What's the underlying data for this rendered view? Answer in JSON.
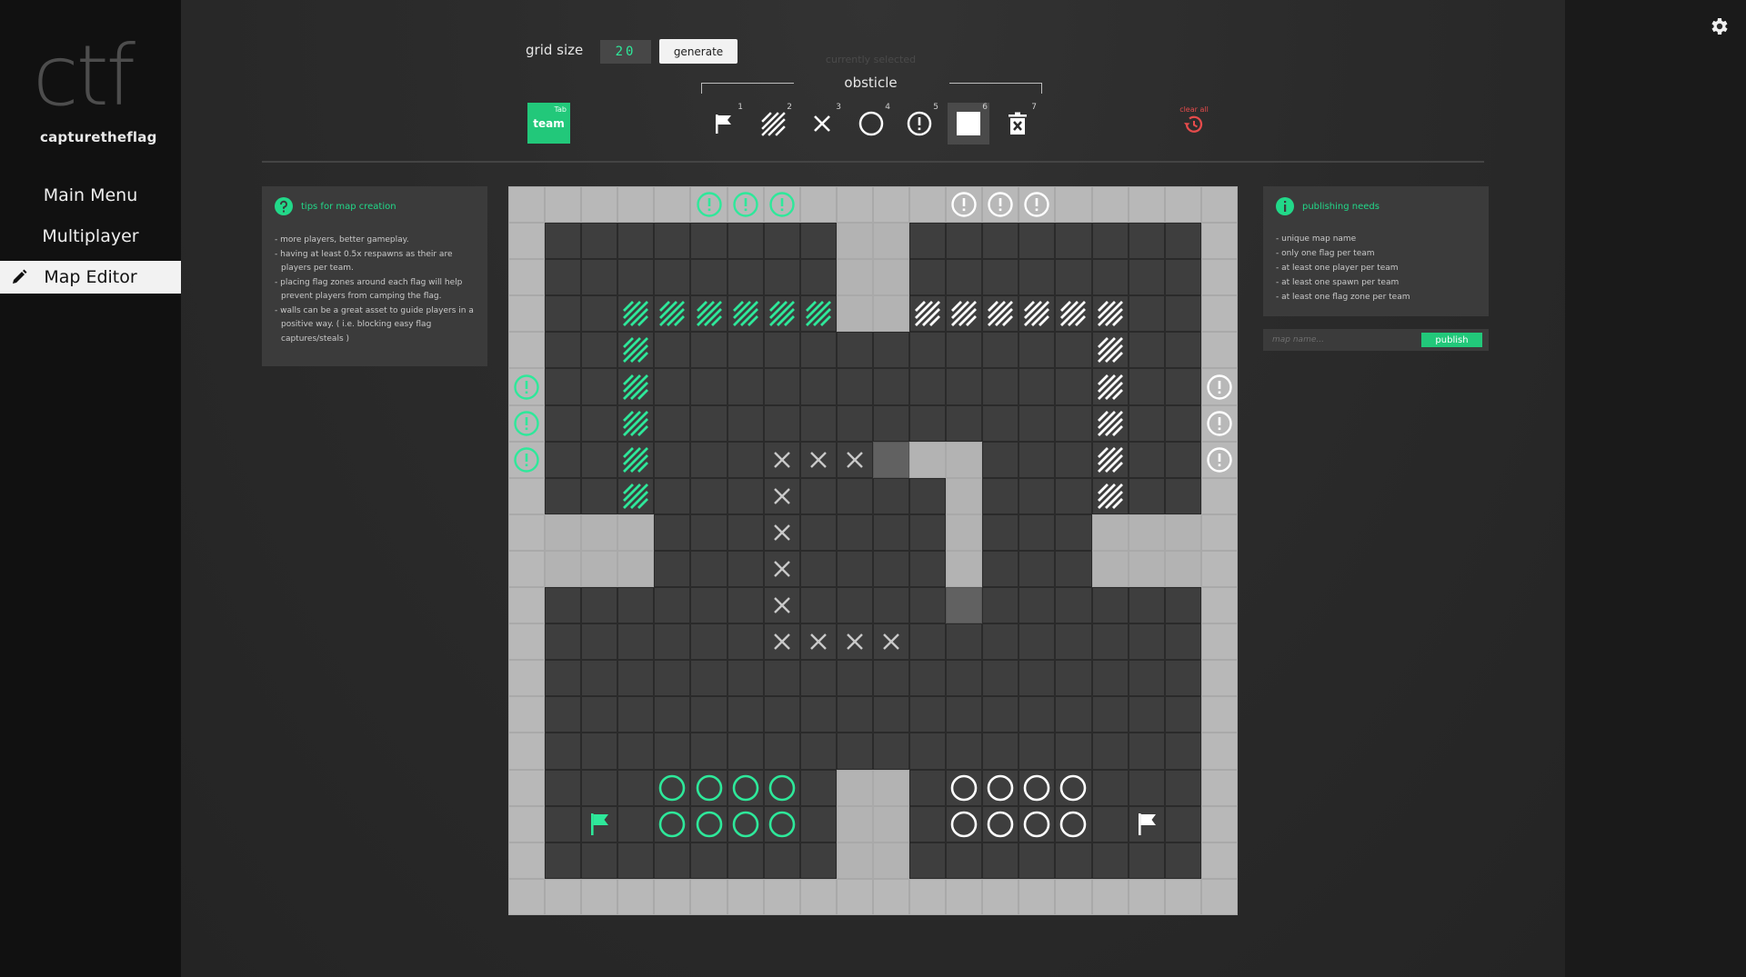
{
  "app": {
    "logo": "ctf",
    "logo_subtitle": "capturetheflag"
  },
  "sidebar": {
    "items": [
      {
        "label": "Main Menu"
      },
      {
        "label": "Multiplayer"
      },
      {
        "label": "Map Editor",
        "active": true,
        "icon": "pencil-icon"
      }
    ]
  },
  "toolbar": {
    "grid_size_label": "grid size",
    "grid_size_value": "20",
    "generate_label": "generate",
    "currently_selected_label": "currently selected",
    "obstacle_label": "obsticle",
    "team_label": "team",
    "team_hint": "Tab",
    "clear_all_label": "clear all",
    "tools": [
      {
        "key": "1",
        "icon": "flag-icon"
      },
      {
        "key": "2",
        "icon": "hatch-icon"
      },
      {
        "key": "3",
        "icon": "x-mark-icon"
      },
      {
        "key": "4",
        "icon": "circle-icon"
      },
      {
        "key": "5",
        "icon": "alert-icon"
      },
      {
        "key": "6",
        "icon": "wall-square-icon",
        "selected": true
      },
      {
        "key": "7",
        "icon": "trash-icon"
      }
    ]
  },
  "tips": {
    "title": "tips for map creation",
    "items": [
      "more players, better gameplay.",
      "having at least 0.5x respawns as their are players per team.",
      "placing flag zones around each flag will help prevent players from camping the flag.",
      "walls can be a great asset to guide players in a positive way. ( i.e. blocking easy flag captures/steals )"
    ]
  },
  "publishing": {
    "title": "publishing needs",
    "items": [
      "unique map name",
      "only one flag per team",
      "at least one player per team",
      "at least one spawn per team",
      "at least one flag zone per team"
    ],
    "map_name_placeholder": "map name...",
    "publish_label": "publish"
  },
  "colors": {
    "accent_green": "#22c87a",
    "team_green": "#2ee89a",
    "team_white": "#ffffff",
    "danger_red": "#e54b4b"
  },
  "map": {
    "size": 20,
    "legend": {
      "W": "wall",
      "E": "edge-wall",
      "D": "floor",
      "M": "dim-floor",
      "g!": "green spawn",
      "w!": "white spawn",
      "g/": "green hatch",
      "w/": "white hatch",
      "x": "x-mark",
      "go": "green zone",
      "wo": "white zone",
      "gF": "green flag",
      "wF": "white flag"
    },
    "rows": [
      [
        "E",
        "E",
        "E",
        "E",
        "E",
        "g!",
        "g!",
        "g!",
        "E",
        "E",
        "E",
        "E",
        "w!",
        "w!",
        "w!",
        "E",
        "E",
        "E",
        "E",
        "E"
      ],
      [
        "E",
        "D",
        "D",
        "D",
        "D",
        "D",
        "D",
        "D",
        "D",
        "W",
        "W",
        "D",
        "D",
        "D",
        "D",
        "D",
        "D",
        "D",
        "D",
        "E"
      ],
      [
        "E",
        "D",
        "D",
        "D",
        "D",
        "D",
        "D",
        "D",
        "D",
        "W",
        "W",
        "D",
        "D",
        "D",
        "D",
        "D",
        "D",
        "D",
        "D",
        "E"
      ],
      [
        "E",
        "D",
        "D",
        "g/",
        "g/",
        "g/",
        "g/",
        "g/",
        "g/",
        "W",
        "W",
        "w/",
        "w/",
        "w/",
        "w/",
        "w/",
        "w/",
        "D",
        "D",
        "E"
      ],
      [
        "E",
        "D",
        "D",
        "g/",
        "D",
        "D",
        "D",
        "D",
        "D",
        "D",
        "D",
        "D",
        "D",
        "D",
        "D",
        "D",
        "w/",
        "D",
        "D",
        "E"
      ],
      [
        "g!",
        "D",
        "D",
        "g/",
        "D",
        "D",
        "D",
        "D",
        "D",
        "D",
        "D",
        "D",
        "D",
        "D",
        "D",
        "D",
        "w/",
        "D",
        "D",
        "w!"
      ],
      [
        "g!",
        "D",
        "D",
        "g/",
        "D",
        "D",
        "D",
        "D",
        "D",
        "D",
        "D",
        "D",
        "D",
        "D",
        "D",
        "D",
        "w/",
        "D",
        "D",
        "w!"
      ],
      [
        "g!",
        "D",
        "D",
        "g/",
        "D",
        "D",
        "D",
        "x",
        "x",
        "x",
        "M",
        "W",
        "W",
        "D",
        "D",
        "D",
        "w/",
        "D",
        "D",
        "w!"
      ],
      [
        "E",
        "D",
        "D",
        "g/",
        "D",
        "D",
        "D",
        "x",
        "D",
        "D",
        "D",
        "D",
        "W",
        "D",
        "D",
        "D",
        "w/",
        "D",
        "D",
        "E"
      ],
      [
        "E",
        "W",
        "W",
        "W",
        "D",
        "D",
        "D",
        "x",
        "D",
        "D",
        "D",
        "D",
        "W",
        "D",
        "D",
        "D",
        "W",
        "W",
        "W",
        "E"
      ],
      [
        "E",
        "W",
        "W",
        "W",
        "D",
        "D",
        "D",
        "x",
        "D",
        "D",
        "D",
        "D",
        "W",
        "D",
        "D",
        "D",
        "W",
        "W",
        "W",
        "E"
      ],
      [
        "E",
        "D",
        "D",
        "D",
        "D",
        "D",
        "D",
        "x",
        "D",
        "D",
        "D",
        "D",
        "M",
        "D",
        "D",
        "D",
        "D",
        "D",
        "D",
        "E"
      ],
      [
        "E",
        "D",
        "D",
        "D",
        "D",
        "D",
        "D",
        "x",
        "x",
        "x",
        "x",
        "D",
        "D",
        "D",
        "D",
        "D",
        "D",
        "D",
        "D",
        "E"
      ],
      [
        "E",
        "D",
        "D",
        "D",
        "D",
        "D",
        "D",
        "D",
        "D",
        "D",
        "D",
        "D",
        "D",
        "D",
        "D",
        "D",
        "D",
        "D",
        "D",
        "E"
      ],
      [
        "E",
        "D",
        "D",
        "D",
        "D",
        "D",
        "D",
        "D",
        "D",
        "D",
        "D",
        "D",
        "D",
        "D",
        "D",
        "D",
        "D",
        "D",
        "D",
        "E"
      ],
      [
        "E",
        "D",
        "D",
        "D",
        "D",
        "D",
        "D",
        "D",
        "D",
        "D",
        "D",
        "D",
        "D",
        "D",
        "D",
        "D",
        "D",
        "D",
        "D",
        "E"
      ],
      [
        "E",
        "D",
        "D",
        "D",
        "go",
        "go",
        "go",
        "go",
        "D",
        "W",
        "W",
        "D",
        "wo",
        "wo",
        "wo",
        "wo",
        "D",
        "D",
        "D",
        "E"
      ],
      [
        "E",
        "D",
        "gF",
        "D",
        "go",
        "go",
        "go",
        "go",
        "D",
        "W",
        "W",
        "D",
        "wo",
        "wo",
        "wo",
        "wo",
        "D",
        "wF",
        "D",
        "E"
      ],
      [
        "E",
        "D",
        "D",
        "D",
        "D",
        "D",
        "D",
        "D",
        "D",
        "W",
        "W",
        "D",
        "D",
        "D",
        "D",
        "D",
        "D",
        "D",
        "D",
        "E"
      ],
      [
        "E",
        "E",
        "E",
        "E",
        "E",
        "E",
        "E",
        "E",
        "E",
        "E",
        "E",
        "E",
        "E",
        "E",
        "E",
        "E",
        "E",
        "E",
        "E",
        "E"
      ]
    ]
  }
}
